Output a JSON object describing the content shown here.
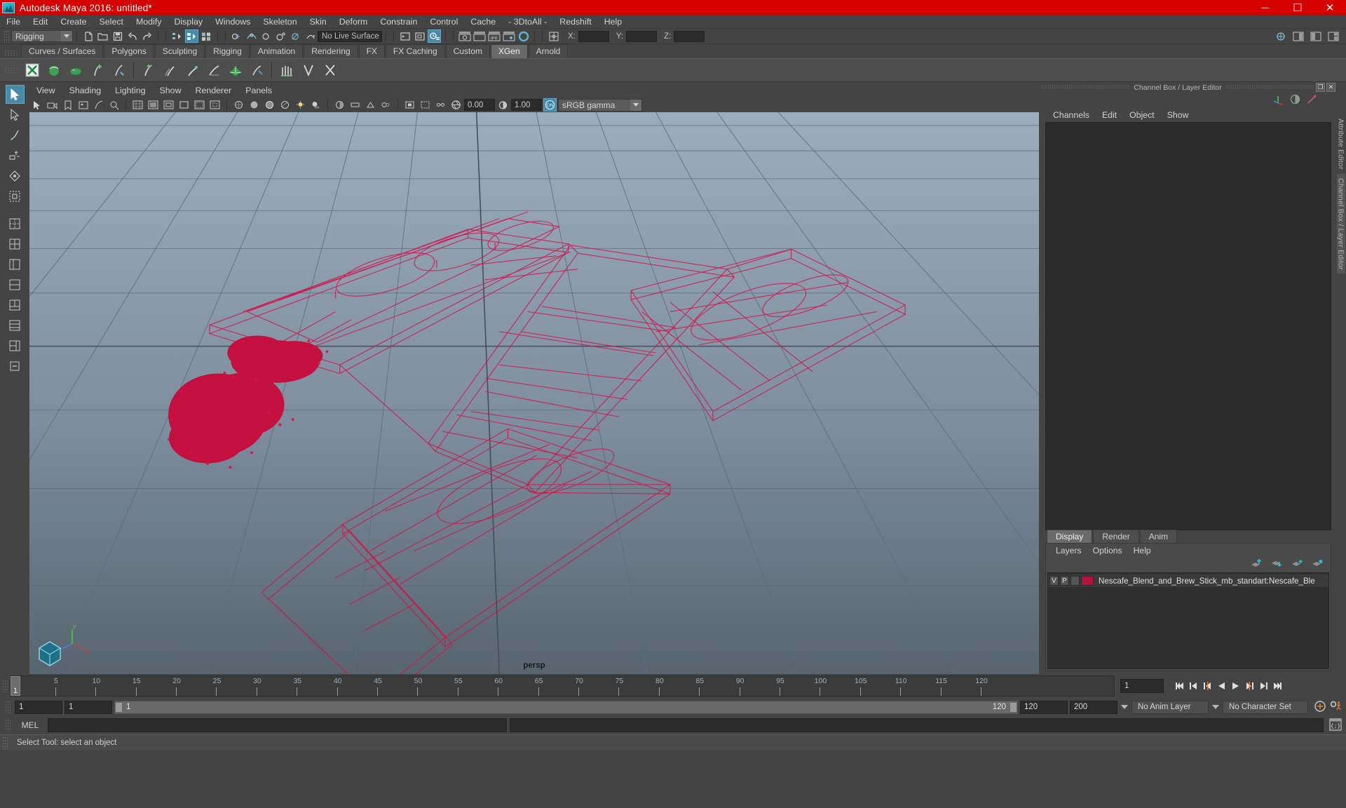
{
  "window": {
    "title": "Autodesk Maya 2016: untitled*",
    "app_icon": "maya-logo-icon",
    "minimize": "─",
    "maximize": "☐",
    "close": "✕",
    "titlebar_color": "#d40000"
  },
  "menubar": {
    "items": [
      "File",
      "Edit",
      "Create",
      "Select",
      "Modify",
      "Display",
      "Windows",
      "Skeleton",
      "Skin",
      "Deform",
      "Constrain",
      "Control",
      "Cache",
      "- 3DtoAll -",
      "Redshift",
      "Help"
    ]
  },
  "toolbar": {
    "menuset_value": "Rigging",
    "live_surface_value": "No Live Surface",
    "coord_labels": [
      "X:",
      "Y:",
      "Z:"
    ],
    "coord_values": [
      "",
      "",
      ""
    ]
  },
  "shelf": {
    "tabs": [
      "Curves / Surfaces",
      "Polygons",
      "Sculpting",
      "Rigging",
      "Animation",
      "Rendering",
      "FX",
      "FX Caching",
      "Custom",
      "XGen",
      "Arnold"
    ],
    "selected_tab": "XGen"
  },
  "toolbox": {
    "items": [
      {
        "name": "select-tool",
        "glyph": "↖",
        "selected": true
      },
      {
        "name": "lasso-tool",
        "glyph": "↗",
        "selected": false
      },
      {
        "name": "paint-select-tool",
        "glyph": "✎",
        "selected": false
      },
      {
        "name": "move-tool",
        "glyph": "✥",
        "selected": false
      },
      {
        "name": "rotate-tool",
        "glyph": "◇",
        "selected": false
      },
      {
        "name": "scale-tool",
        "glyph": "▣",
        "selected": false
      }
    ],
    "layout_items": [
      {
        "name": "layout-single-perspective",
        "glyph": "◈"
      },
      {
        "name": "layout-four-view",
        "glyph": "⊞"
      },
      {
        "name": "layout-persp-outliner",
        "glyph": "▥"
      },
      {
        "name": "layout-hypergraph",
        "glyph": "▤"
      },
      {
        "name": "layout-persp-graph",
        "glyph": "▦"
      },
      {
        "name": "layout-two-stacked",
        "glyph": "▧"
      },
      {
        "name": "layout-persp-uv",
        "glyph": "▨"
      },
      {
        "name": "layout-more",
        "glyph": "·"
      }
    ]
  },
  "viewport": {
    "menus": [
      "View",
      "Shading",
      "Lighting",
      "Show",
      "Renderer",
      "Panels"
    ],
    "exposure_value": "0.00",
    "gamma_value": "1.00",
    "color_management_toggle": "ON",
    "color_profile": "sRGB gamma",
    "camera_label": "persp",
    "axis_labels": [
      "y",
      "x",
      "z"
    ],
    "background_top": "#96a8ba",
    "background_bottom": "#5d6b7c",
    "wireframe_color": "#d1164a",
    "grid_color": "#5f6d7c"
  },
  "channelbox": {
    "panel_title": "Channel Box / Layer Editor",
    "menus": [
      "Channels",
      "Edit",
      "Object",
      "Show"
    ],
    "restore_glyph": "❐",
    "close_glyph": "✕"
  },
  "layer_editor": {
    "tabs": [
      "Display",
      "Render",
      "Anim"
    ],
    "selected_tab": "Display",
    "menus": [
      "Layers",
      "Options",
      "Help"
    ],
    "buttons": [
      "move-layer-up-icon",
      "move-layer-down-icon",
      "new-layer-icon",
      "new-layer-from-selected-icon"
    ],
    "layers": [
      {
        "visibility": "V",
        "playback": "P",
        "type": "",
        "color": "#b0153c",
        "name": "Nescafe_Blend_and_Brew_Stick_mb_standart:Nescafe_Ble"
      }
    ]
  },
  "right_edge": {
    "tabs": [
      "Attribute Editor",
      "Channel Box / Layer Editor"
    ]
  },
  "timeline": {
    "start_label": "1",
    "current_frame": "1",
    "ticks": [
      5,
      10,
      15,
      20,
      25,
      30,
      35,
      40,
      45,
      50,
      55,
      60,
      65,
      70,
      75,
      80,
      85,
      90,
      95,
      100,
      105,
      110,
      115,
      120
    ],
    "range_min": 1,
    "range_max": 120,
    "frame_field": "1",
    "playback_buttons": [
      "go-to-start-icon",
      "step-back-key-icon",
      "step-back-frame-icon",
      "play-backwards-icon",
      "play-forwards-icon",
      "step-forward-frame-icon",
      "step-forward-key-icon",
      "go-to-end-icon"
    ]
  },
  "range_slider": {
    "anim_start": "1",
    "range_start": "1",
    "bar_start": "1",
    "bar_end": "120",
    "range_end": "120",
    "anim_end": "200",
    "anim_layer": "No Anim Layer",
    "character_set": "No Character Set",
    "auto_key_icon": "auto-keyframe-icon",
    "anim_prefs_icon": "animation-preferences-icon"
  },
  "command_line": {
    "label": "MEL",
    "input_value": "",
    "output_value": "",
    "script_editor_icon": "script-editor-icon"
  },
  "status": {
    "message": "Select Tool: select an object"
  }
}
